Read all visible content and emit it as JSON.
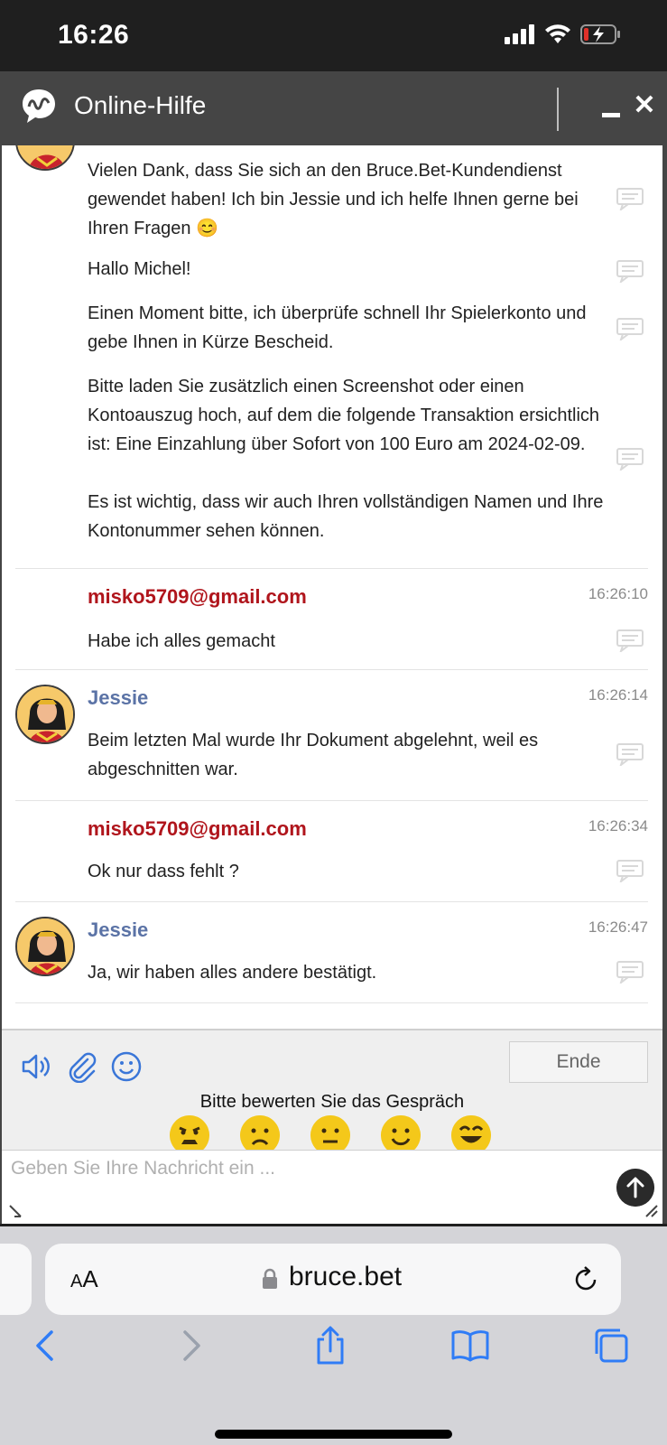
{
  "status_bar": {
    "time": "16:26"
  },
  "header": {
    "title": "Online-Hilfe"
  },
  "messages": [
    {
      "role": "agent",
      "sender": "",
      "time": "",
      "texts": [
        "Vielen Dank, dass Sie sich an den Bruce.Bet-Kundendienst gewendet haben! Ich bin Jessie und ich helfe Ihnen gerne bei Ihren Fragen 😊",
        "Hallo Michel!",
        "Einen Moment bitte, ich überprüfe schnell Ihr Spielerkonto und gebe Ihnen in Kürze Bescheid.",
        "Bitte laden Sie zusätzlich einen Screenshot oder einen Kontoauszug hoch, auf dem die folgende Transaktion ersichtlich ist: Eine Einzahlung über Sofort von 100 Euro am 2024-02-09.",
        "Es ist wichtig, dass wir auch Ihren vollständigen Namen und Ihre Kontonummer sehen können."
      ]
    },
    {
      "role": "user",
      "sender": "misko5709@gmail.com",
      "time": "16:26:10",
      "texts": [
        "Habe ich alles gemacht"
      ]
    },
    {
      "role": "agent",
      "sender": "Jessie",
      "time": "16:26:14",
      "texts": [
        "Beim letzten Mal wurde Ihr Dokument abgelehnt, weil es abgeschnitten war."
      ]
    },
    {
      "role": "user",
      "sender": "misko5709@gmail.com",
      "time": "16:26:34",
      "texts": [
        "Ok nur dass fehlt ?"
      ]
    },
    {
      "role": "agent",
      "sender": "Jessie",
      "time": "16:26:47",
      "texts": [
        "Ja, wir haben alles andere bestätigt."
      ]
    }
  ],
  "toolbar": {
    "end_label": "Ende",
    "rate_label": "Bitte bewerten Sie das Gespräch",
    "ratings": [
      "angry",
      "sad",
      "neutral",
      "happy",
      "very-happy"
    ]
  },
  "input": {
    "placeholder": "Geben Sie Ihre Nachricht ein ..."
  },
  "browser": {
    "text_size_label": "AA",
    "url": "bruce.bet"
  },
  "colors": {
    "agent_name": "#5b73a6",
    "user_name": "#b0151c",
    "header_bg": "#454545"
  }
}
